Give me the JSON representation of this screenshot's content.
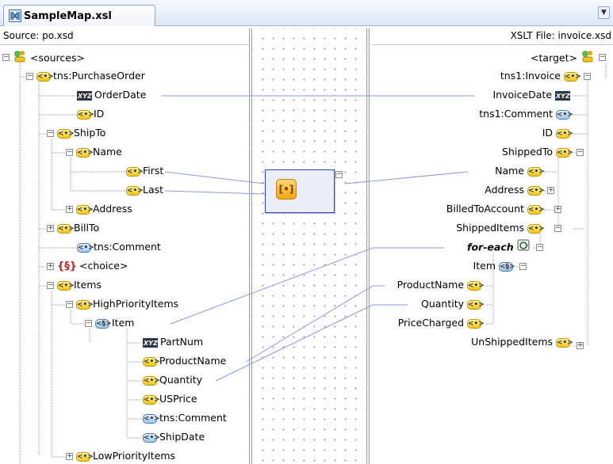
{
  "editor": {
    "tab_title": "SampleMap.xsl",
    "source_header": "Source: po.xsd",
    "target_header": "XSLT File: invoice.xsd"
  },
  "icons": {
    "tab": "xsl-map-icon",
    "tab_dropdown": "chevron-down-icon",
    "element": "element-icon",
    "attribute": "attribute-icon",
    "choice": "choice-icon",
    "root": "schema-root-icon",
    "for_each": "for-each-icon",
    "function": "function-icon"
  },
  "source_tree": {
    "sources": "<sources>",
    "purchase_order": "tns:PurchaseOrder",
    "order_date": "OrderDate",
    "id": "ID",
    "ship_to": "ShipTo",
    "name": "Name",
    "first": "First",
    "last": "Last",
    "address": "Address",
    "billto": "BillTo",
    "comment": "tns:Comment",
    "choice": "<choice>",
    "items": "Items",
    "high_priority": "HighPriorityItems",
    "item": "Item",
    "part_num": "PartNum",
    "product_name": "ProductName",
    "quantity": "Quantity",
    "usprice": "USPrice",
    "item_comment": "tns:Comment",
    "ship_date": "ShipDate",
    "low_priority": "LowPriorityItems"
  },
  "target_tree": {
    "target": "<target>",
    "invoice": "tns1:Invoice",
    "invoice_date": "InvoiceDate",
    "comment": "tns1:Comment",
    "id": "ID",
    "shipped_to": "ShippedTo",
    "name": "Name",
    "address": "Address",
    "billed_to_account": "BilledToAccount",
    "shipped_items": "ShippedItems",
    "for_each": "for-each",
    "item": "Item",
    "product_name": "ProductName",
    "quantity": "Quantity",
    "price_charged": "PriceCharged",
    "unshipped_items": "UnShippedItems"
  },
  "colors": {
    "link_line": "#8e96e0",
    "function_border": "#2f49c0",
    "element_icon": "#f3c41b"
  }
}
